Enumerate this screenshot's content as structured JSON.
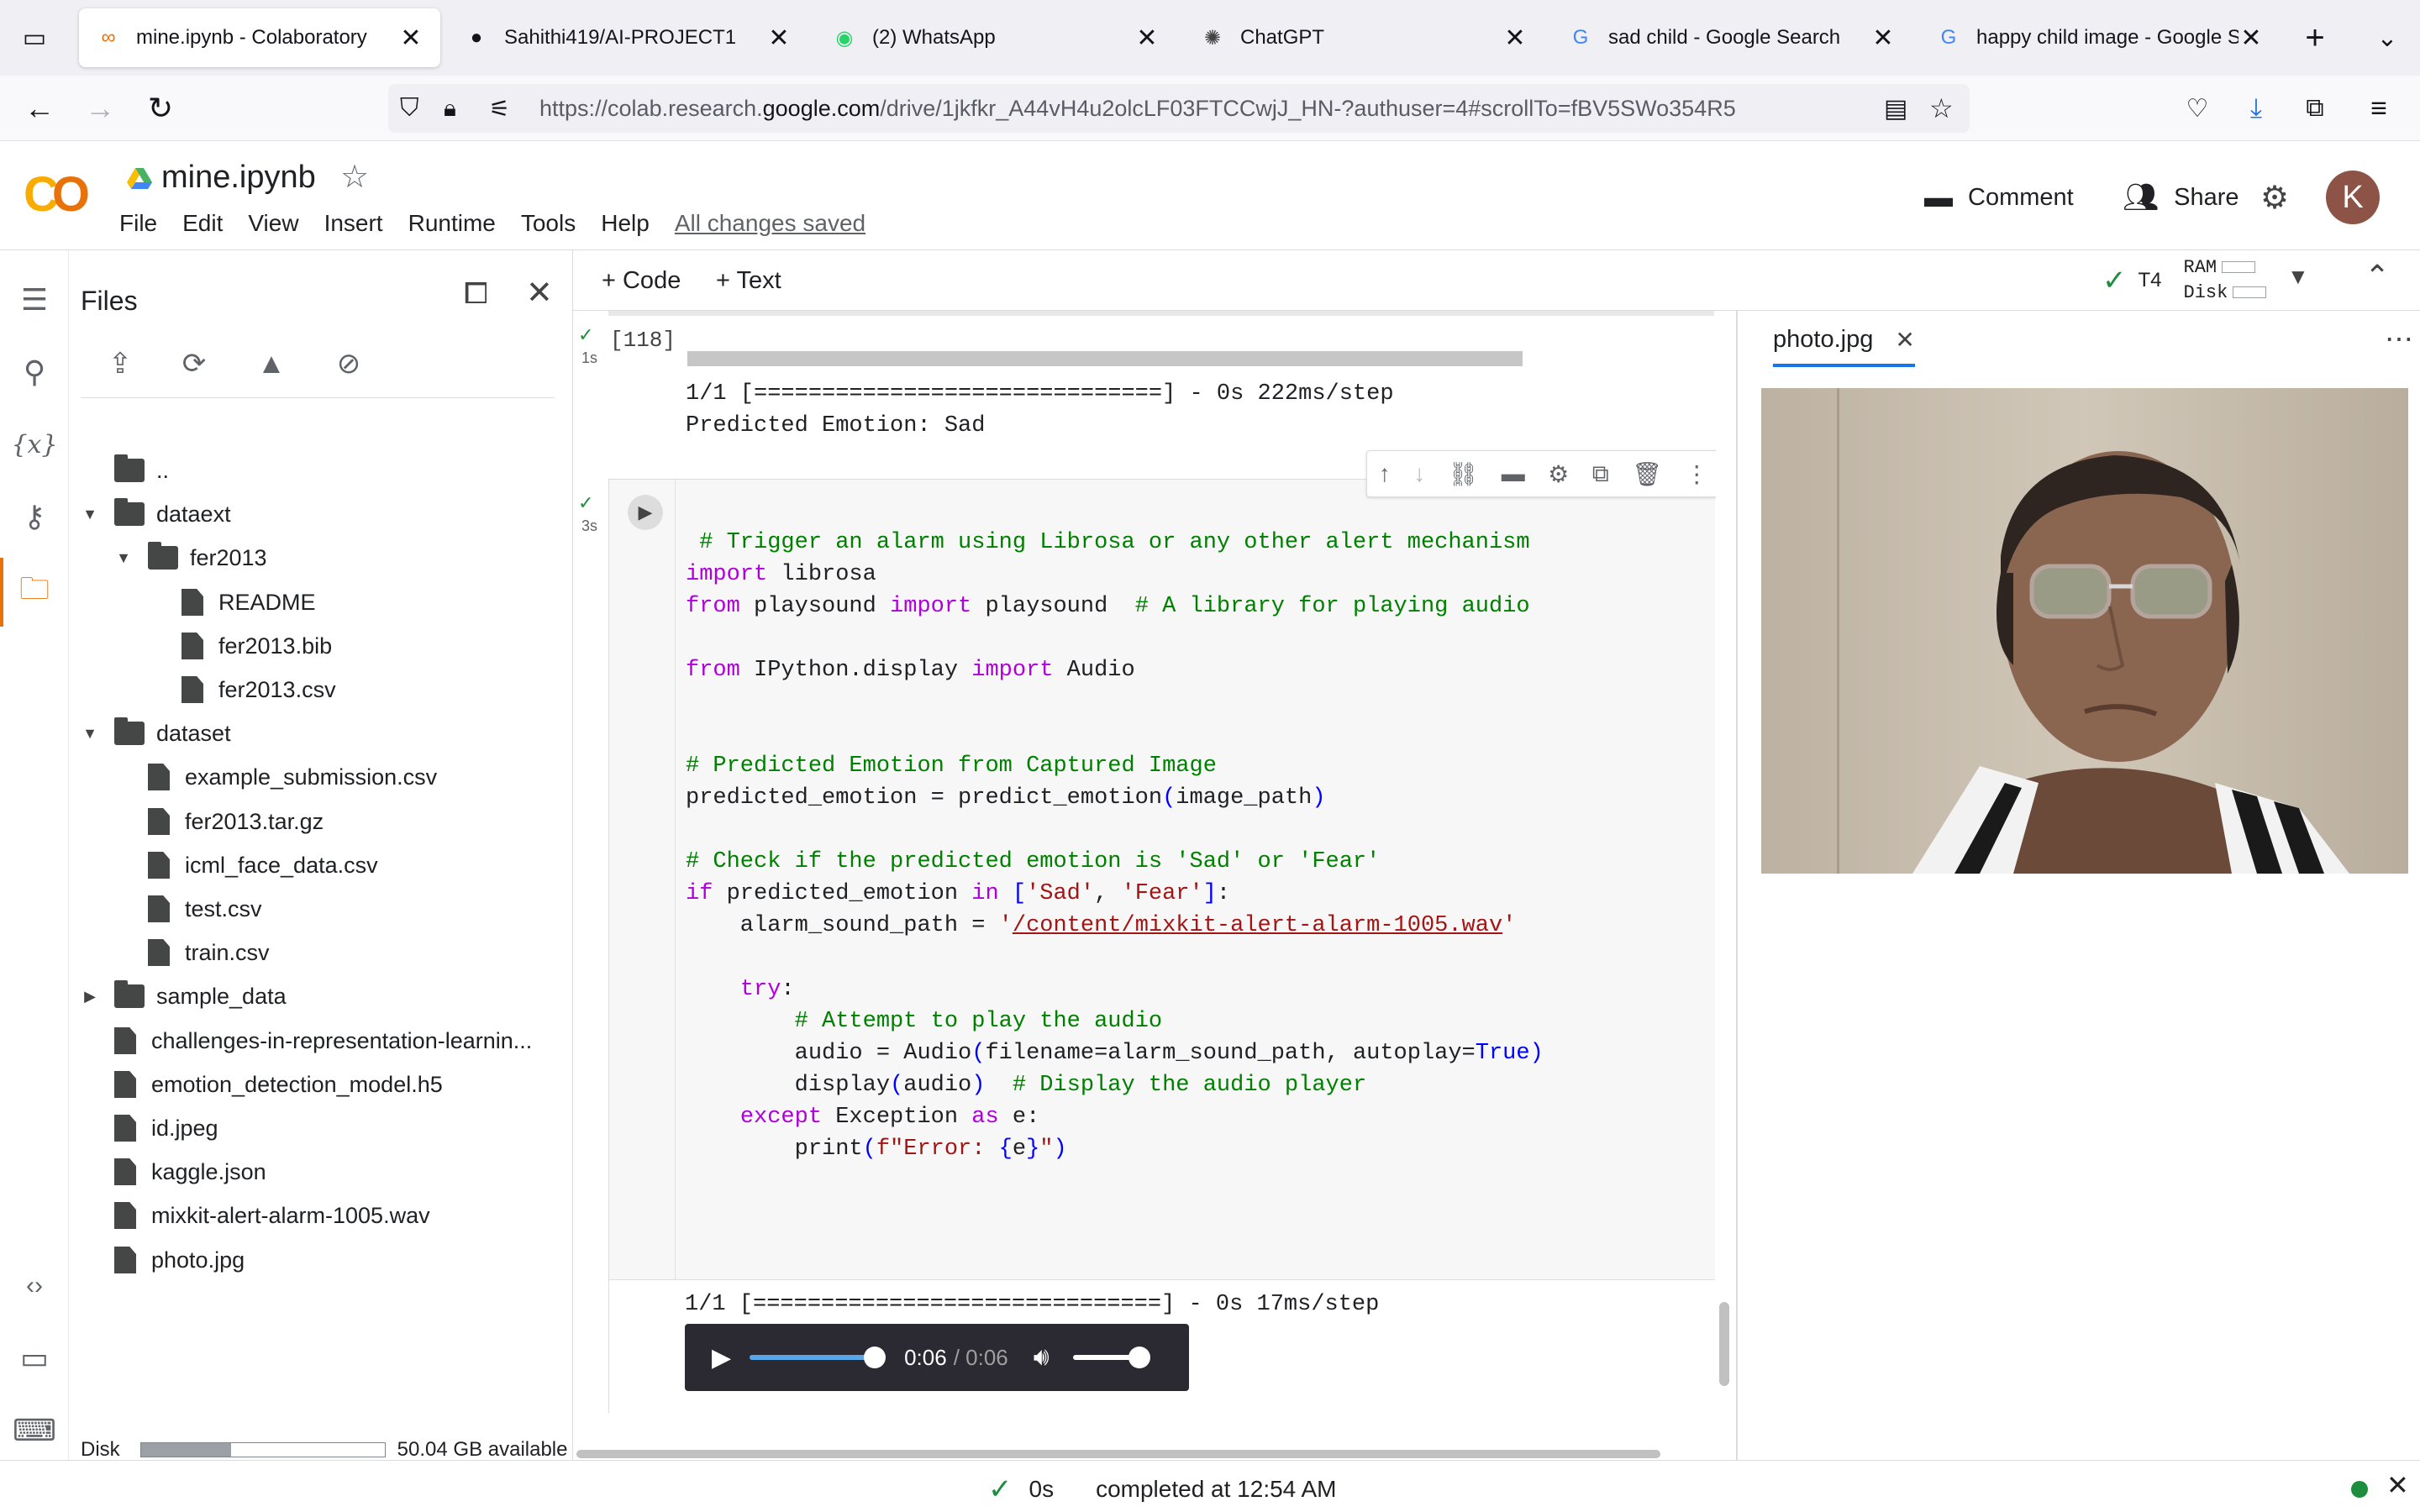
{
  "browser": {
    "tabs": [
      {
        "label": "mine.ipynb - Colaboratory",
        "icon": "colab-icon",
        "active": true
      },
      {
        "label": "Sahithi419/AI-PROJECT1",
        "icon": "github-icon"
      },
      {
        "label": "(2) WhatsApp",
        "icon": "whatsapp-icon"
      },
      {
        "label": "ChatGPT",
        "icon": "chatgpt-icon"
      },
      {
        "label": "sad child - Google Search",
        "icon": "google-icon"
      },
      {
        "label": "happy child image - Google Se",
        "icon": "google-icon"
      }
    ],
    "url_prefix": "https://colab.research.",
    "url_domain": "google.com",
    "url_rest": "/drive/1jkfkr_A44vH4u2olcLF03FTCCwjJ_HN-?authuser=4#scrollTo=fBV5SWo354R5"
  },
  "colab": {
    "notebook_title": "mine.ipynb",
    "menu": [
      "File",
      "Edit",
      "View",
      "Insert",
      "Runtime",
      "Tools",
      "Help"
    ],
    "saved_status": "All changes saved",
    "comment_label": "Comment",
    "share_label": "Share",
    "avatar_letter": "K",
    "add_code": "+ Code",
    "add_text": "+ Text",
    "runtime": {
      "gpu": "T4",
      "ram_label": "RAM",
      "disk_label": "Disk"
    }
  },
  "files_panel": {
    "title": "Files",
    "tree": [
      {
        "label": "..",
        "depth": 0,
        "kind": "up"
      },
      {
        "label": "dataext",
        "depth": 0,
        "kind": "folder",
        "expanded": true
      },
      {
        "label": "fer2013",
        "depth": 1,
        "kind": "folder",
        "expanded": true
      },
      {
        "label": "README",
        "depth": 2,
        "kind": "file"
      },
      {
        "label": "fer2013.bib",
        "depth": 2,
        "kind": "file"
      },
      {
        "label": "fer2013.csv",
        "depth": 2,
        "kind": "file"
      },
      {
        "label": "dataset",
        "depth": 0,
        "kind": "folder",
        "expanded": true
      },
      {
        "label": "example_submission.csv",
        "depth": 1,
        "kind": "file"
      },
      {
        "label": "fer2013.tar.gz",
        "depth": 1,
        "kind": "file"
      },
      {
        "label": "icml_face_data.csv",
        "depth": 1,
        "kind": "file"
      },
      {
        "label": "test.csv",
        "depth": 1,
        "kind": "file"
      },
      {
        "label": "train.csv",
        "depth": 1,
        "kind": "file"
      },
      {
        "label": "sample_data",
        "depth": 0,
        "kind": "folder",
        "expanded": false
      },
      {
        "label": "challenges-in-representation-learnin...",
        "depth": 0,
        "kind": "file"
      },
      {
        "label": "emotion_detection_model.h5",
        "depth": 0,
        "kind": "file"
      },
      {
        "label": "id.jpeg",
        "depth": 0,
        "kind": "file"
      },
      {
        "label": "kaggle.json",
        "depth": 0,
        "kind": "file"
      },
      {
        "label": "mixkit-alert-alarm-1005.wav",
        "depth": 0,
        "kind": "file"
      },
      {
        "label": "photo.jpg",
        "depth": 0,
        "kind": "file"
      }
    ],
    "disk_label": "Disk",
    "disk_available": "50.04 GB available",
    "disk_used_fraction": 0.37
  },
  "cell1": {
    "exec_count": "[118]",
    "exec_time": "1s",
    "progress_line": "1/1 [==============================] - 0s 222ms/step",
    "result_line": "Predicted Emotion: Sad"
  },
  "cell2": {
    "exec_time": "3s",
    "output_line": "1/1 [==============================] - 0s 17ms/step",
    "audio_time": "0:06",
    "audio_duration": "/ 0:06"
  },
  "viewer": {
    "tab_label": "photo.jpg"
  },
  "statusbar": {
    "elapsed": "0s",
    "completed": "completed at 12:54 AM"
  }
}
